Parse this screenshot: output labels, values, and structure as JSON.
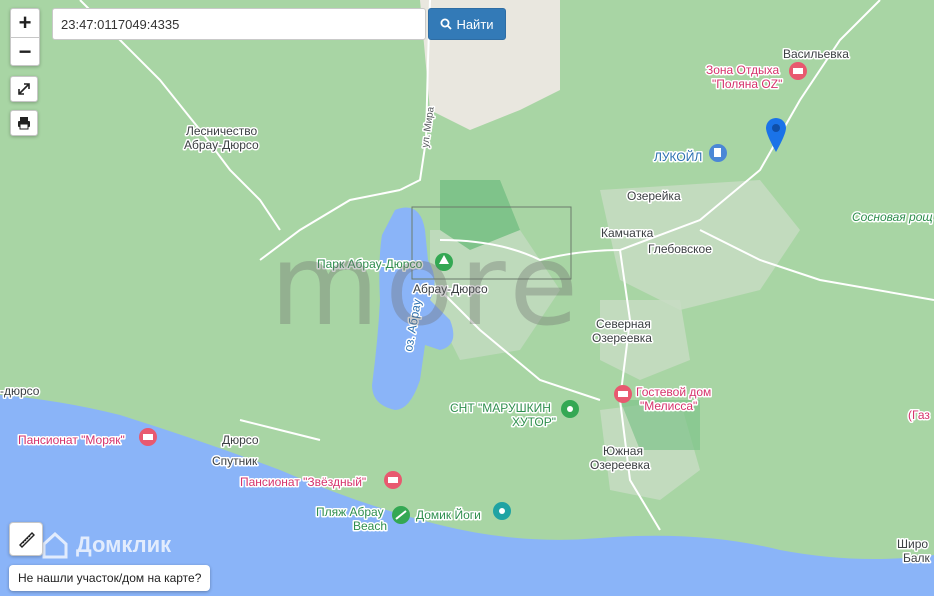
{
  "toolbar": {
    "zoom_in_label": "+",
    "zoom_out_label": "−",
    "search_value": "23:47:0117049:4335",
    "search_button_label": "Найти"
  },
  "map": {
    "places": {
      "vasilevka": "Васильевка",
      "ozereika": "Озерейка",
      "kamchatka": "Камчатка",
      "glebovskoe": "Глебовское",
      "abrau": "Абрау-Дюрсо",
      "sev_oz_1": "Северная",
      "sev_oz_2": "Озереевка",
      "yuzh_oz_1": "Южная",
      "yuzh_oz_2": "Озереевка",
      "lesn_1": "Лесничество",
      "lesn_2": "Абрау-Дюрсо",
      "durso": "Дюрсо",
      "sputnik": "Спутник",
      "durso_left": "-дюрсо",
      "shiron_1": "Широ",
      "shiron_2": "Балк"
    },
    "pois": {
      "polyana_1": "Зона Отдыха",
      "polyana_2": "\"Поляна OZ\"",
      "lukoil": "ЛУКОЙЛ",
      "park": "Парк Абрау-Дюрсо",
      "melissa_1": "Гостевой дом",
      "melissa_2": "\"Мелисса\"",
      "marushkin_1": "СНТ \"МАРУШКИН",
      "marushkin_2": "ХУТОР\"",
      "moryak": "Пансионат \"Моряк\"",
      "zvezdny": "Пансионат \"Звёздный\"",
      "beach_1": "Пляж Абрау",
      "beach_2": "Beach",
      "yoga": "Домик Йоги",
      "sosnovaya": "Сосновая рощ",
      "gas": "(Газ"
    },
    "water": {
      "lake": "оз. Абрау"
    },
    "roads": {
      "mira": "ул. Мира"
    }
  },
  "overlay": {
    "watermark": "more",
    "brand": "Домклик"
  },
  "footer": {
    "not_found": "Не нашли участок/дом на карте?"
  },
  "colors": {
    "land": "#a8d5a4",
    "sea": "#8ab4f8",
    "accent": "#337ab7",
    "poi": "#d6336c",
    "marker": "#1a73e8"
  }
}
